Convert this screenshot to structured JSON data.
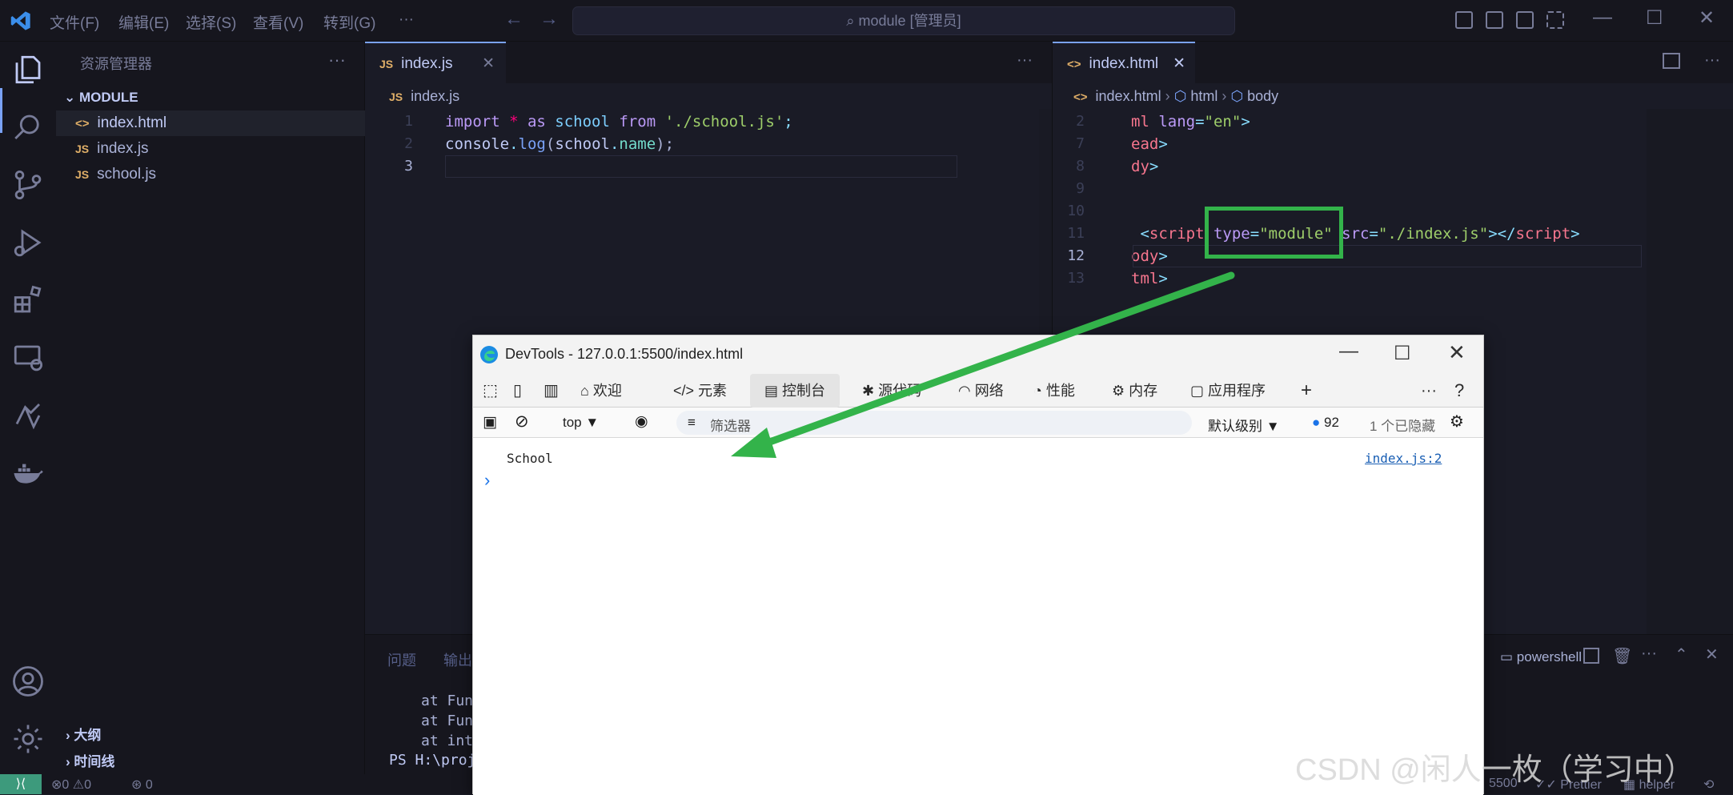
{
  "titlebar": {
    "menu": [
      "文件(F)",
      "编辑(E)",
      "选择(S)",
      "查看(V)",
      "转到(G)",
      "···"
    ],
    "command_center": "module [管理员]"
  },
  "sidebar": {
    "title": "资源管理器",
    "folder": "MODULE",
    "files": [
      {
        "name": "index.html",
        "type": "html"
      },
      {
        "name": "index.js",
        "type": "js"
      },
      {
        "name": "school.js",
        "type": "js"
      }
    ],
    "outline": "大纲",
    "timeline": "时间线"
  },
  "editor_left": {
    "tab": "index.js",
    "breadcrumb": "index.js",
    "lines": [
      {
        "n": "1",
        "tokens": [
          [
            "import ",
            "#bb9af7"
          ],
          [
            "* ",
            "#ff007c"
          ],
          [
            "as ",
            "#bb9af7"
          ],
          [
            "school ",
            "#7dcfff"
          ],
          [
            "from ",
            "#bb9af7"
          ],
          [
            "'./school.js'",
            "#9ece6a"
          ],
          [
            ";",
            "#89ddff"
          ]
        ]
      },
      {
        "n": "2",
        "tokens": [
          [
            "console",
            "#c0caf5"
          ],
          [
            ".",
            "#89ddff"
          ],
          [
            "log",
            "#7aa2f7"
          ],
          [
            "(",
            "#a9b1d6"
          ],
          [
            "school",
            "#c0caf5"
          ],
          [
            ".",
            "#89ddff"
          ],
          [
            "name",
            "#73daca"
          ],
          [
            ");",
            "#a9b1d6"
          ]
        ]
      },
      {
        "n": "3",
        "tokens": []
      }
    ]
  },
  "editor_right": {
    "tab": "index.html",
    "breadcrumb": [
      "index.html",
      "html",
      "body"
    ],
    "lines": [
      {
        "n": "2",
        "tokens": [
          [
            "ml ",
            "#f7768e"
          ],
          [
            "lang",
            "#bb9af7"
          ],
          [
            "=",
            "#89ddff"
          ],
          [
            "\"en\"",
            "#9ece6a"
          ],
          [
            ">",
            "#89ddff"
          ]
        ]
      },
      {
        "n": "7",
        "tokens": [
          [
            "ead",
            "#f7768e"
          ],
          [
            ">",
            "#89ddff"
          ]
        ]
      },
      {
        "n": "8",
        "tokens": [
          [
            "dy",
            "#f7768e"
          ],
          [
            ">",
            "#89ddff"
          ]
        ]
      },
      {
        "n": "9",
        "tokens": []
      },
      {
        "n": "10",
        "tokens": []
      },
      {
        "n": "11",
        "tokens": [
          [
            " <",
            "#89ddff"
          ],
          [
            "script ",
            "#f7768e"
          ],
          [
            "type",
            "#bb9af7"
          ],
          [
            "=",
            "#89ddff"
          ],
          [
            "\"module\" ",
            "#9ece6a"
          ],
          [
            "src",
            "#bb9af7"
          ],
          [
            "=",
            "#89ddff"
          ],
          [
            "\"./index.js\"",
            "#9ece6a"
          ],
          [
            "></",
            "#89ddff"
          ],
          [
            "script",
            "#f7768e"
          ],
          [
            ">",
            "#89ddff"
          ]
        ]
      },
      {
        "n": "12",
        "tokens": [
          [
            "ody",
            "#f7768e"
          ],
          [
            ">",
            "#89ddff"
          ]
        ]
      },
      {
        "n": "13",
        "tokens": [
          [
            "tml",
            "#f7768e"
          ],
          [
            ">",
            "#89ddff"
          ]
        ]
      }
    ]
  },
  "panel": {
    "tabs": [
      "问题",
      "输出"
    ],
    "terminal_name": "powershell",
    "lines": [
      "at Fun",
      "at Fun",
      "at int",
      "PS H:\\proj"
    ]
  },
  "statusbar": {
    "errors": "0",
    "warnings": "0",
    "ports": "0",
    "port": "5500",
    "prettier": "Prettier",
    "helper": "helper"
  },
  "devtools": {
    "title": "DevTools - 127.0.0.1:5500/index.html",
    "tabs": [
      "欢迎",
      "元素",
      "控制台",
      "源代码",
      "网络",
      "性能",
      "内存",
      "应用程序"
    ],
    "context": "top",
    "filter_placeholder": "筛选器",
    "level": "默认级别",
    "issues": "92",
    "hidden": "1 个已隐藏",
    "log_text": "School",
    "log_source": "index.js:2"
  },
  "watermark": "CSDN @闲人一枚（学习中）",
  "colors": {
    "highlight": "#33b34a",
    "accent": "#7aa2f7"
  }
}
